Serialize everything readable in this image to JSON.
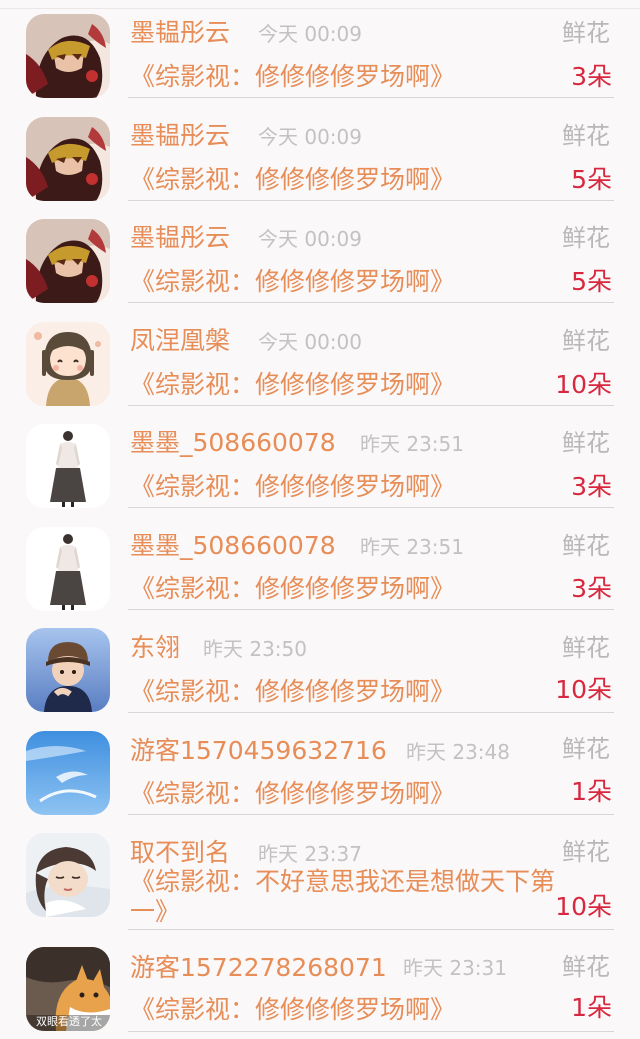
{
  "rows": [
    {
      "name": "墨韫彤云",
      "time": "今天 00:09",
      "gift": "鲜花",
      "book": "《综影视：修修修修罗场啊》",
      "count": "3朵",
      "avatar": "masked-woman"
    },
    {
      "name": "墨韫彤云",
      "time": "今天 00:09",
      "gift": "鲜花",
      "book": "《综影视：修修修修罗场啊》",
      "count": "5朵",
      "avatar": "masked-woman"
    },
    {
      "name": "墨韫彤云",
      "time": "今天 00:09",
      "gift": "鲜花",
      "book": "《综影视：修修修修罗场啊》",
      "count": "5朵",
      "avatar": "masked-woman"
    },
    {
      "name": "凤涅凰槃",
      "time": "今天 00:00",
      "gift": "鲜花",
      "book": "《综影视：修修修修罗场啊》",
      "count": "10朵",
      "avatar": "chibi-girl"
    },
    {
      "name": "墨墨_508660078",
      "time": "昨天 23:51",
      "gift": "鲜花",
      "book": "《综影视：修修修修罗场啊》",
      "count": "3朵",
      "avatar": "fashion-figure"
    },
    {
      "name": "墨墨_508660078",
      "time": "昨天 23:51",
      "gift": "鲜花",
      "book": "《综影视：修修修修罗场啊》",
      "count": "3朵",
      "avatar": "fashion-figure"
    },
    {
      "name": "东翎",
      "time": "昨天 23:50",
      "gift": "鲜花",
      "book": "《综影视：修修修修罗场啊》",
      "count": "10朵",
      "avatar": "boy-hat"
    },
    {
      "name": "游客1570459632716",
      "time": "昨天 23:48",
      "gift": "鲜花",
      "book": "《综影视：修修修修罗场啊》",
      "count": "1朵",
      "avatar": "blue-sky"
    },
    {
      "name": "取不到名",
      "time": "昨天 23:37",
      "gift": "鲜花",
      "book": "《综影视：不好意思我还是想做天下第一》",
      "count": "10朵",
      "avatar": "sleeping-woman"
    },
    {
      "name": "游客1572278268071",
      "time": "昨天 23:31",
      "gift": "鲜花",
      "book": "《综影视：修修修修罗场啊》",
      "count": "1朵",
      "avatar": "cat-meme",
      "avatar_caption": "双眼看透了太"
    }
  ]
}
